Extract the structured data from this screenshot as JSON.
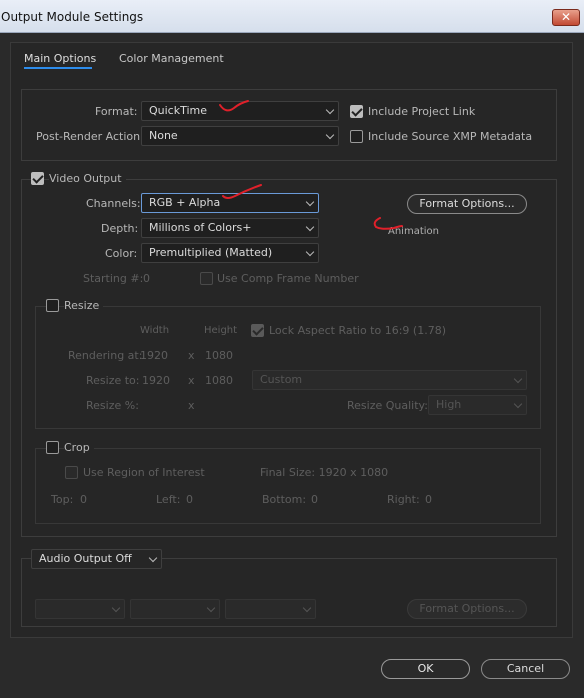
{
  "window": {
    "title": "Output Module Settings",
    "close_label": "✕"
  },
  "tabs": {
    "main_options": "Main Options",
    "color_management": "Color Management"
  },
  "format_section": {
    "format_label": "Format:",
    "format_value": "QuickTime",
    "post_render_label": "Post-Render Action:",
    "post_render_value": "None",
    "include_project_link": "Include Project Link",
    "include_xmp": "Include Source XMP Metadata"
  },
  "video_output": {
    "label": "Video Output",
    "channels_label": "Channels:",
    "channels_value": "RGB + Alpha",
    "depth_label": "Depth:",
    "depth_value": "Millions of Colors+",
    "color_label": "Color:",
    "color_value": "Premultiplied (Matted)",
    "starting_label": "Starting #:",
    "starting_value": "0",
    "use_comp_frame": "Use Comp Frame Number",
    "format_options": "Format Options...",
    "codec_note": "Animation"
  },
  "resize": {
    "label": "Resize",
    "width_header": "Width",
    "height_header": "Height",
    "lock_aspect": "Lock Aspect Ratio to 16:9 (1.78)",
    "rendering_at_label": "Rendering at:",
    "rendering_w": "1920",
    "rendering_x": "x",
    "rendering_h": "1080",
    "resize_to_label": "Resize to:",
    "resize_w": "1920",
    "resize_x": "x",
    "resize_h": "1080",
    "preset_value": "Custom",
    "resize_pct_label": "Resize %:",
    "resize_pct_x": "x",
    "quality_label": "Resize Quality:",
    "quality_value": "High"
  },
  "crop": {
    "label": "Crop",
    "use_roi": "Use Region of Interest",
    "final_size": "Final Size: 1920 x 1080",
    "top_label": "Top:",
    "top_value": "0",
    "left_label": "Left:",
    "left_value": "0",
    "bottom_label": "Bottom:",
    "bottom_value": "0",
    "right_label": "Right:",
    "right_value": "0"
  },
  "audio": {
    "output_value": "Audio Output Off",
    "format_options": "Format Options..."
  },
  "footer": {
    "ok": "OK",
    "cancel": "Cancel"
  },
  "colors": {
    "accent": "#2d8ceb",
    "annotation": "#e0202a",
    "bg": "#2a2a2a"
  }
}
